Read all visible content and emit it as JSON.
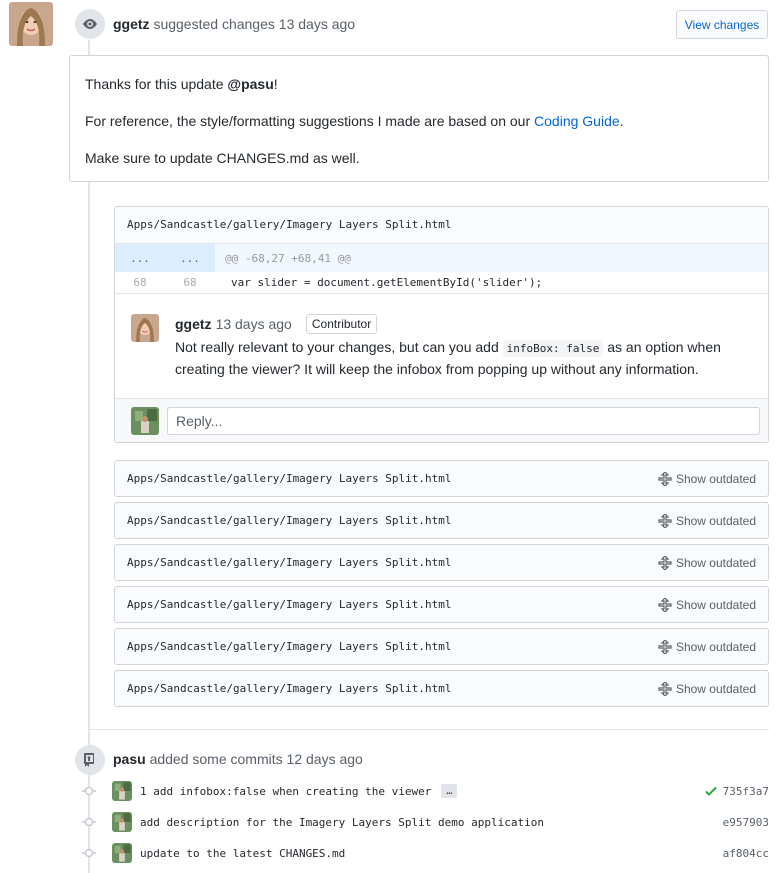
{
  "review": {
    "author": "ggetz",
    "action": "suggested changes",
    "time": "13 days ago",
    "view_changes_label": "View changes",
    "body": {
      "line1_prefix": "Thanks for this update ",
      "line1_mention": "@pasu",
      "line1_suffix": "!",
      "line2_prefix": "For reference, the style/formatting suggestions I made are based on our ",
      "line2_link": "Coding Guide",
      "line2_suffix": ".",
      "line3": "Make sure to update CHANGES.md as well."
    }
  },
  "file_comment": {
    "path": "Apps/Sandcastle/gallery/Imagery Layers Split.html",
    "hunk": {
      "left": "...",
      "right": "...",
      "text": "@@ -68,27 +68,41 @@"
    },
    "code_line": {
      "left": "68",
      "right": "68",
      "text": "var slider = document.getElementById('slider');"
    },
    "comment": {
      "author": "ggetz",
      "time": "13 days ago",
      "badge": "Contributor",
      "text_prefix": "Not really relevant to your changes, but can you add ",
      "code": "infoBox: false",
      "text_suffix": " as an option when creating the viewer? It will keep the infobox from popping up without any information."
    },
    "reply_placeholder": "Reply..."
  },
  "outdated_files": [
    {
      "path": "Apps/Sandcastle/gallery/Imagery Layers Split.html",
      "label": "Show outdated"
    },
    {
      "path": "Apps/Sandcastle/gallery/Imagery Layers Split.html",
      "label": "Show outdated"
    },
    {
      "path": "Apps/Sandcastle/gallery/Imagery Layers Split.html",
      "label": "Show outdated"
    },
    {
      "path": "Apps/Sandcastle/gallery/Imagery Layers Split.html",
      "label": "Show outdated"
    },
    {
      "path": "Apps/Sandcastle/gallery/Imagery Layers Split.html",
      "label": "Show outdated"
    },
    {
      "path": "Apps/Sandcastle/gallery/Imagery Layers Split.html",
      "label": "Show outdated"
    }
  ],
  "commits_event": {
    "author": "pasu",
    "action": "added some commits",
    "time": "12 days ago",
    "commits": [
      {
        "message": "1 add infobox:false when creating the viewer",
        "ellipsis": "…",
        "sha": "735f3a7",
        "status": "success"
      },
      {
        "message": "add description for the Imagery Layers Split demo application",
        "sha": "e957903"
      },
      {
        "message": "update to the latest CHANGES.md",
        "sha": "af804cc"
      }
    ]
  },
  "colors": {
    "link": "#0366d6",
    "success": "#28a745"
  }
}
